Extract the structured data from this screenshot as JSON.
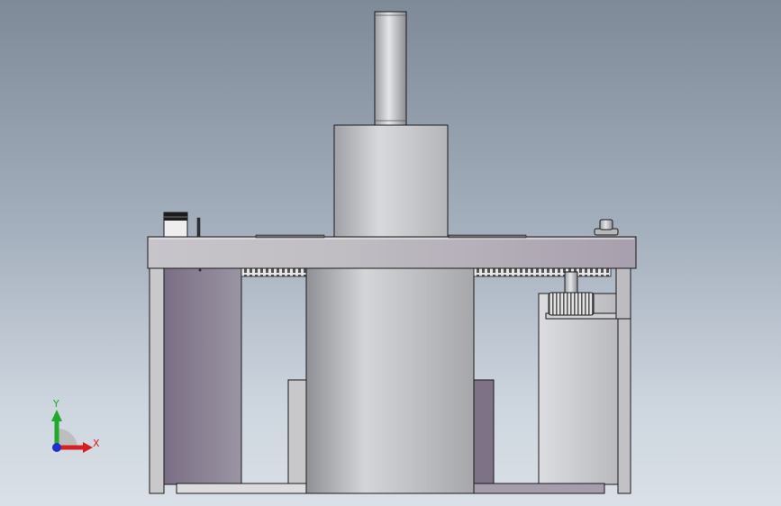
{
  "triad": {
    "y_label": "Y",
    "x_label": "X",
    "y_color": "#1faa2b",
    "x_color": "#d42020",
    "z_color": "#2030c8"
  },
  "colors": {
    "background_top": "#7f8a98",
    "background_bottom": "#d9e0e7",
    "part_light": "#d8dadd",
    "part_mid": "#a9abb0",
    "part_dark": "#7d6f84",
    "edge": "#1a1a1a"
  }
}
